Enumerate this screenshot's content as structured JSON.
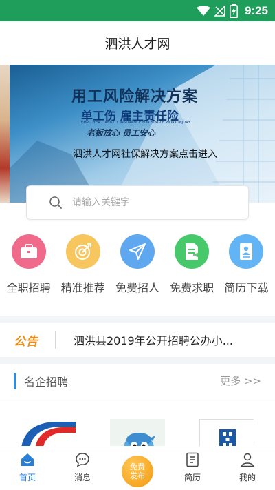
{
  "status_bar": {
    "time": "9:25",
    "color": "#1e9e5a"
  },
  "header": {
    "title": "泗洪人才网"
  },
  "banner": {
    "headline": "用工风险解决方案",
    "subheadline": "单工伤 雇主责任险",
    "english": "EMPLOYER LIABILITY INSURANCE FOR SINGLE WORK INJURY",
    "slogan": "老板放心 员工安心",
    "link_text": "泗洪人才网社保解决方案点击进入"
  },
  "search": {
    "placeholder": "请输入关键字",
    "value": ""
  },
  "quick_actions": [
    {
      "label": "全职招聘",
      "icon": "briefcase-icon",
      "color": "#f06b8b"
    },
    {
      "label": "精准推荐",
      "icon": "target-icon",
      "color": "#f8c65e"
    },
    {
      "label": "免费招人",
      "icon": "paper-plane-icon",
      "color": "#5fa8ef"
    },
    {
      "label": "免费求职",
      "icon": "resume-icon",
      "color": "#47c86b"
    },
    {
      "label": "简历下载",
      "icon": "document-person-icon",
      "color": "#62b4f5"
    }
  ],
  "notice": {
    "tag": "公告",
    "text": "泗洪县2019年公开招聘公办小..."
  },
  "featured": {
    "title": "名企招聘",
    "more": "更多 >>"
  },
  "tabs": [
    {
      "label": "首页",
      "icon": "home-icon",
      "active": true
    },
    {
      "label": "消息",
      "icon": "chat-icon",
      "active": false
    },
    {
      "label": "免费",
      "label2": "发布",
      "icon": "post-button",
      "active": false
    },
    {
      "label": "简历",
      "icon": "resume-icon",
      "active": false
    },
    {
      "label": "我的",
      "icon": "user-icon",
      "active": false
    }
  ],
  "colors": {
    "accent": "#2a8fde",
    "notice_tag": "#f08a13",
    "post_button": "#f5a623"
  }
}
